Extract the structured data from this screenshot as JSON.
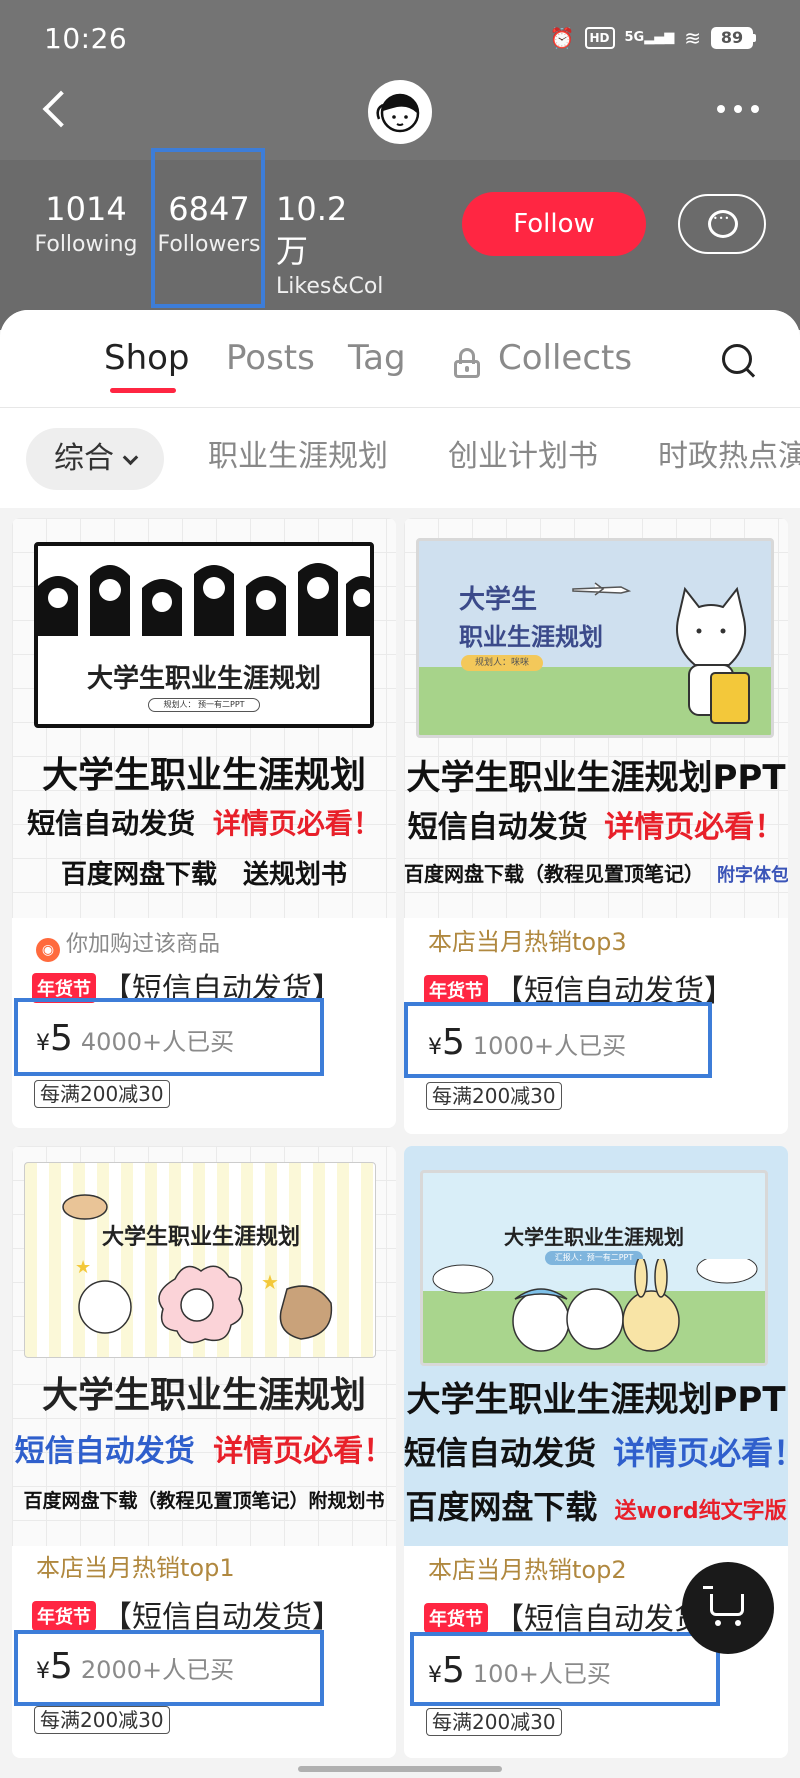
{
  "status_bar": {
    "time": "10:26",
    "hd": "HD",
    "signal": "5G",
    "battery": "89"
  },
  "header": {
    "back_icon": "chevron-left-icon",
    "more_icon": "more-dots-icon"
  },
  "stats": {
    "following_count": "1014",
    "following_label": "Following",
    "followers_count": "6847",
    "followers_label": "Followers",
    "likes_count": "10.2 万",
    "likes_label": "Likes&Col",
    "follow_button": "Follow",
    "message_icon": "chat-bubble-icon"
  },
  "tabs": [
    {
      "label": "Shop",
      "active": true
    },
    {
      "label": "Posts",
      "active": false
    },
    {
      "label": "Tag",
      "active": false
    },
    {
      "label": "Collects",
      "active": false
    }
  ],
  "filters": {
    "dropdown": "综合",
    "items": [
      "职业生涯规划",
      "创业计划书",
      "时政热点演"
    ]
  },
  "products": [
    {
      "slide_title": "大学生职业生涯规划",
      "slide_sub": "规划人：",
      "slide_sub2": "预一有二PPT",
      "cap1": "大学生职业生涯规划",
      "cap2a": "短信自动发货",
      "cap2b": "详情页必看！",
      "cap3": "百度网盘下载　送规划书",
      "meta": "你加购过该商品",
      "tag": "年货节",
      "title": "【短信自动发货】",
      "yen": "¥",
      "price": "5",
      "sold": "4000+人已买",
      "promo": "每满200减30"
    },
    {
      "slide_title": "大学生",
      "slide_title2": "职业生涯规划",
      "slide_sub": "规划人：咪咪",
      "cap1": "大学生职业生涯规划PPT",
      "cap2a": "短信自动发货",
      "cap2b": "详情页必看！",
      "cap3": "百度网盘下载（教程见置顶笔记）",
      "cap3b": "附字体包",
      "meta": "本店当月热销top3",
      "tag": "年货节",
      "title": "【短信自动发货】",
      "yen": "¥",
      "price": "5",
      "sold": "1000+人已买",
      "promo": "每满200减30"
    },
    {
      "slide_title": "大学生职业生涯规划",
      "cap1": "大学生职业生涯规划",
      "cap2a": "短信自动发货",
      "cap2b": "详情页必看！",
      "cap3": "百度网盘下载（教程见置顶笔记）附规划书",
      "meta": "本店当月热销top1",
      "tag": "年货节",
      "title": "【短信自动发货】",
      "yen": "¥",
      "price": "5",
      "sold": "2000+人已买",
      "promo": "每满200减30"
    },
    {
      "slide_title": "大学生职业生涯规划",
      "slide_sub": "汇报人：预一有二PPT",
      "cap1": "大学生职业生涯规划PPT",
      "cap2a": "短信自动发货",
      "cap2b": "详情页必看！",
      "cap3": "百度网盘下载",
      "cap3b": "送word纯文字版",
      "meta": "本店当月热销top2",
      "tag": "年货节",
      "title": "【短信自动发货】",
      "yen": "¥",
      "price": "5",
      "sold": "100+人已买",
      "promo": "每满200减30"
    }
  ],
  "colors": {
    "accent": "#ff2642",
    "highlight_box": "#3d7dd8",
    "meta_gold": "#b0883f"
  },
  "cart_icon": "shopping-cart-icon"
}
